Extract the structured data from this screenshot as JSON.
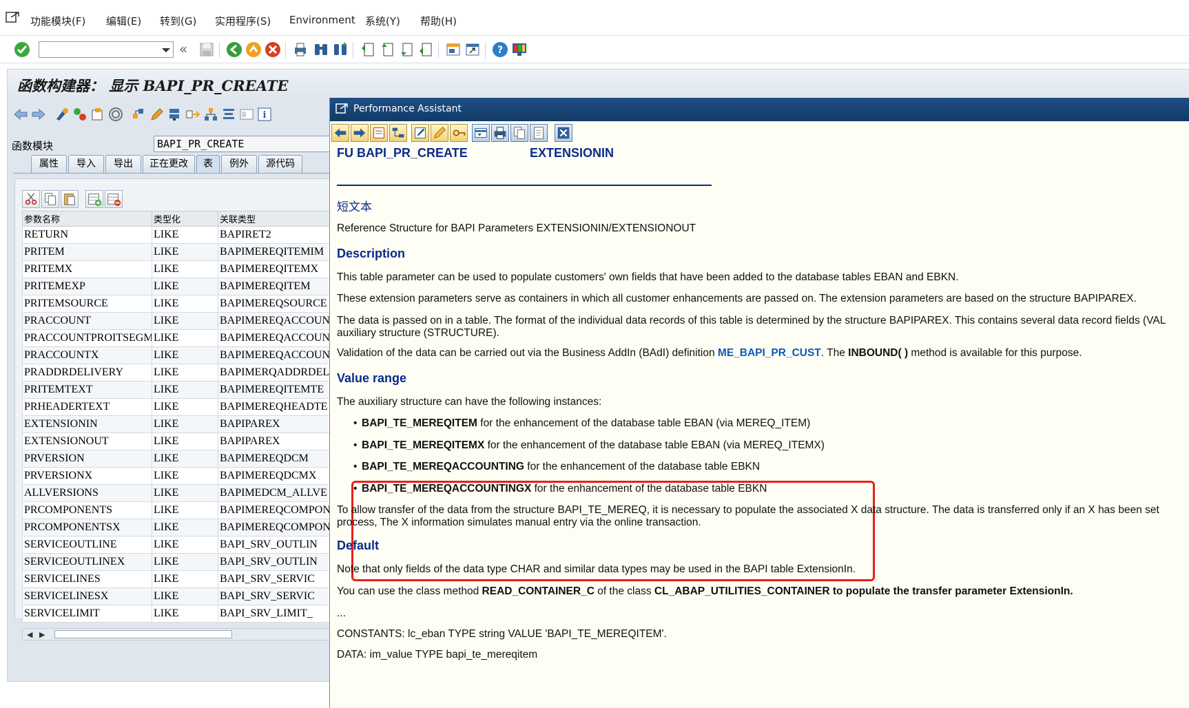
{
  "menubar": {
    "items": [
      "功能模块(F)",
      "编辑(E)",
      "转到(G)",
      "实用程序(S)",
      "Environment",
      "系统(Y)",
      "帮助(H)"
    ]
  },
  "toolbar": {
    "command_value": "",
    "icons": [
      "enter-icon",
      "back-double-icon",
      "save-icon",
      "back-icon",
      "exit-icon",
      "cancel-icon",
      "print-icon",
      "find-icon",
      "find-next-icon",
      "first-page-icon",
      "previous-page-icon",
      "next-page-icon",
      "last-page-icon",
      "new-session-icon",
      "shortcut-icon",
      "help-icon",
      "customize-layout-icon"
    ]
  },
  "window": {
    "title": "函数构建器： 显示 BAPI_PR_CREATE",
    "function_module_label": "函数模块",
    "function_module_value": "BAPI_PR_CREATE",
    "tabs": [
      "属性",
      "导入",
      "导出",
      "正在更改",
      "表",
      "例外",
      "源代码"
    ],
    "active_tab": "表"
  },
  "params_table": {
    "headers": [
      "参数名称",
      "类型化",
      "关联类型"
    ],
    "rows": [
      [
        "RETURN",
        "LIKE",
        "BAPIRET2"
      ],
      [
        "PRITEM",
        "LIKE",
        "BAPIMEREQITEMIM"
      ],
      [
        "PRITEMX",
        "LIKE",
        "BAPIMEREQITEMX"
      ],
      [
        "PRITEMEXP",
        "LIKE",
        "BAPIMEREQITEM"
      ],
      [
        "PRITEMSOURCE",
        "LIKE",
        "BAPIMEREQSOURCE"
      ],
      [
        "PRACCOUNT",
        "LIKE",
        "BAPIMEREQACCOUNT"
      ],
      [
        "PRACCOUNTPROITSEGME…",
        "LIKE",
        "BAPIMEREQACCOUNT"
      ],
      [
        "PRACCOUNTX",
        "LIKE",
        "BAPIMEREQACCOUNT"
      ],
      [
        "PRADDRDELIVERY",
        "LIKE",
        "BAPIMERQADDRDEL"
      ],
      [
        "PRITEMTEXT",
        "LIKE",
        "BAPIMEREQITEMTE"
      ],
      [
        "PRHEADERTEXT",
        "LIKE",
        "BAPIMEREQHEADTE"
      ],
      [
        "EXTENSIONIN",
        "LIKE",
        "BAPIPAREX"
      ],
      [
        "EXTENSIONOUT",
        "LIKE",
        "BAPIPAREX"
      ],
      [
        "PRVERSION",
        "LIKE",
        "BAPIMEREQDCM"
      ],
      [
        "PRVERSIONX",
        "LIKE",
        "BAPIMEREQDCMX"
      ],
      [
        "ALLVERSIONS",
        "LIKE",
        "BAPIMEDCM_ALLVE"
      ],
      [
        "PRCOMPONENTS",
        "LIKE",
        "BAPIMEREQCOMPON"
      ],
      [
        "PRCOMPONENTSX",
        "LIKE",
        "BAPIMEREQCOMPON"
      ],
      [
        "SERVICEOUTLINE",
        "LIKE",
        "BAPI_SRV_OUTLIN"
      ],
      [
        "SERVICEOUTLINEX",
        "LIKE",
        "BAPI_SRV_OUTLIN"
      ],
      [
        "SERVICELINES",
        "LIKE",
        "BAPI_SRV_SERVIC"
      ],
      [
        "SERVICELINESX",
        "LIKE",
        "BAPI_SRV_SERVIC"
      ],
      [
        "SERVICELIMIT",
        "LIKE",
        "BAPI_SRV_LIMIT_"
      ]
    ]
  },
  "assistant": {
    "title": "Performance Assistant",
    "fu_label": "FU BAPI_PR_CREATE",
    "param_label": "EXTENSIONIN",
    "short_text_heading": "短文本",
    "short_text": "Reference Structure for BAPI Parameters EXTENSIONIN/EXTENSIONOUT",
    "description_heading": "Description",
    "desc_p1": "This table parameter can be used to populate customers' own fields that have been added to the database tables EBAN and EBKN.",
    "desc_p2": "These extension parameters serve as containers in which all customer enhancements are passed on. The extension parameters are based on the structure BAPIPAREX.",
    "desc_p3_line1": "The data is passed on in a table. The format of the individual data records of this table is determined by the structure BAPIPAREX. This contains several data record fields (VAL",
    "desc_p3_line2": "auxiliary structure (STRUCTURE).",
    "desc_p4_pre": "Validation of the data can be carried out via the Business AddIn (BAdI) definition ",
    "desc_p4_link": "ME_BAPI_PR_CUST",
    "desc_p4_mid": ". The ",
    "desc_p4_bold": "INBOUND( )",
    "desc_p4_post": " method is available for this purpose.",
    "value_range_heading": "Value range",
    "vr_intro": "The auxiliary structure can have the following instances:",
    "instances": [
      {
        "name": "BAPI_TE_MEREQITEM",
        "text": " for the enhancement of the database table EBAN (via MEREQ_ITEM)"
      },
      {
        "name": "BAPI_TE_MEREQITEMX",
        "text": " for the enhancement of the database table EBAN (via MEREQ_ITEMX)"
      },
      {
        "name": "BAPI_TE_MEREQACCOUNTING",
        "text": " for the enhancement of the database table EBKN"
      },
      {
        "name": "BAPI_TE_MEREQACCOUNTINGX",
        "text": " for the enhancement of the database table EBKN"
      }
    ],
    "vr_transfer_line1": "To allow transfer of the data from the structure BAPI_TE_MEREQ, it is necessary to populate the associated X data structure. The data is transferred only if an X has been set",
    "vr_transfer_line2": "process, The X information simulates manual entry via the online transaction.",
    "default_heading": "Default",
    "def_p1": "Note that only fields of the data type CHAR and similar data types may be used in the BAPI table ExtensionIn.",
    "def_p2_pre": "You can use the class method ",
    "def_p2_b1": "READ_CONTAINER_C",
    "def_p2_mid": " of the class ",
    "def_p2_b2": "CL_ABAP_UTILITIES_CONTAINER to populate the transfer parameter ExtensionIn.",
    "ellipsis": "...",
    "code_line1": "CONSTANTS: lc_eban  TYPE string VALUE 'BAPI_TE_MEREQITEM'.",
    "code_line2": "DATA: im_value TYPE bapi_te_mereqitem"
  },
  "colors": {
    "heading_blue": "#0a2b8c",
    "link_blue": "#0a5bbf",
    "highlight_red": "#e8201a",
    "assistant_bg": "#fefef4",
    "titlebar_blue": "#1f4f86"
  }
}
